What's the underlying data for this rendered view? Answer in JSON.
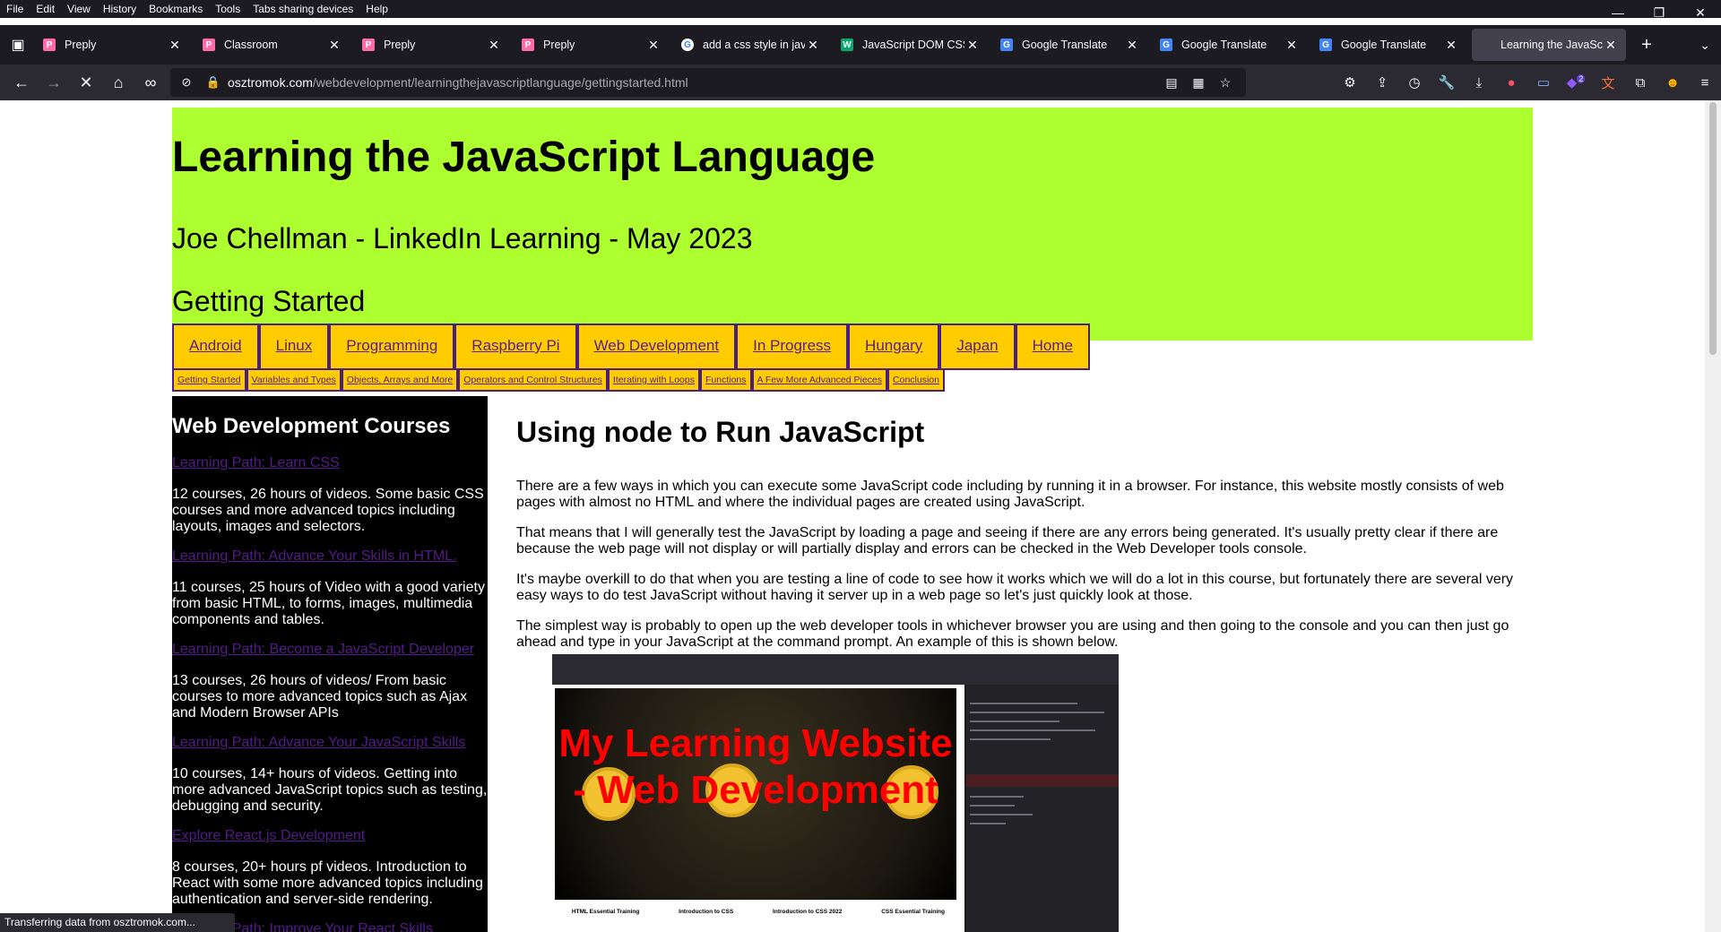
{
  "menubar": [
    "File",
    "Edit",
    "View",
    "History",
    "Bookmarks",
    "Tools",
    "Tabs sharing devices",
    "Help"
  ],
  "tabs": [
    {
      "title": "Preply",
      "favicon": "preply-icon",
      "color": "#ff6ba8",
      "glyph": "P"
    },
    {
      "title": "Classroom",
      "favicon": "preply-icon",
      "color": "#ff6ba8",
      "glyph": "P"
    },
    {
      "title": "Preply",
      "favicon": "preply-icon",
      "color": "#ff6ba8",
      "glyph": "P"
    },
    {
      "title": "Preply",
      "favicon": "preply-icon",
      "color": "#ff6ba8",
      "glyph": "P"
    },
    {
      "title": "add a css style in javasc",
      "favicon": "google-icon",
      "color": "#ffffff",
      "glyph": "G"
    },
    {
      "title": "JavaScript DOM CSS",
      "favicon": "w3schools-icon",
      "color": "#04aa6d",
      "glyph": "W"
    },
    {
      "title": "Google Translate",
      "favicon": "translate-icon",
      "color": "#4285f4",
      "glyph": "G"
    },
    {
      "title": "Google Translate",
      "favicon": "translate-icon",
      "color": "#4285f4",
      "glyph": "G"
    },
    {
      "title": "Google Translate",
      "favicon": "translate-icon",
      "color": "#4285f4",
      "glyph": "G"
    },
    {
      "title": "Learning the JavaScript",
      "favicon": "site-icon",
      "color": "#42414d",
      "glyph": "",
      "active": true
    }
  ],
  "url": {
    "host": "osztromok.com",
    "path": "/webdevelopment/learningthejavascriptlanguage/gettingstarted.html"
  },
  "header": {
    "title": "Learning the JavaScript Language",
    "subtitle": "Joe Chellman - LinkedIn Learning - May 2023",
    "page": "Getting Started",
    "bg_color": "#adff2f"
  },
  "main_nav": [
    "Android",
    "Linux",
    "Programming",
    "Raspberry Pi",
    "Web Development",
    "In Progress",
    "Hungary",
    "Japan",
    "Home"
  ],
  "sub_nav": [
    "Getting Started",
    "Variables and Types",
    "Objects, Arrays and More",
    "Operators and Control Structures",
    "Iterating with Loops",
    "Functions",
    "A Few More Advanced Pieces",
    "Conclusion"
  ],
  "sidebar": {
    "heading": "Web Development Courses",
    "courses": [
      {
        "link": "Learning Path: Learn CSS",
        "desc": "12 courses, 26 hours of videos. Some basic CSS courses and more advanced topics including layouts, images and selectors."
      },
      {
        "link": "Learning Path: Advance Your Skills in HTML.",
        "desc": "11 courses, 25 hours of Video with a good variety from basic HTML, to forms, images, multimedia components and tables."
      },
      {
        "link": "Learning Path: Become a JavaScript Developer",
        "desc": "13 courses, 26 hours of videos/ From basic courses to more advanced topics such as Ajax and Modern Browser APIs"
      },
      {
        "link": "Learning Path: Advance Your JavaScript Skills",
        "desc": "10 courses, 14+ hours of videos. Getting into more advanced JavaScript topics such as testing, debugging and security."
      },
      {
        "link": "Explore React.js Development",
        "desc": "8 courses, 20+ hours pf videos. Introduction to React with some more advanced topics including authentication and server-side rendering."
      },
      {
        "link": "Learning Path: Improve Your React Skills",
        "desc": ""
      }
    ]
  },
  "content": {
    "heading": "Using node to Run JavaScript",
    "paragraphs": [
      "There are a few ways in which you can execute some JavaScript code including by running it in a browser. For instance, this website mostly consists of web pages with almost no HTML and where the individual pages are created using JavaScript.",
      "That means that I will generally test the JavaScript by loading a page and seeing if there are any errors being generated. It's usually pretty clear if there are because the web page will not display or will partially display and errors can be checked in the Web Developer tools console.",
      "It's maybe overkill to do that when you are testing a line of code to see how it works which we will do a lot in this course, but fortunately there are several very easy ways to do test JavaScript without having it server up in a web page so let's just quickly look at those.",
      "The simplest way is probably to open up the web developer tools in whichever browser you are using and then going to the console and you can then just go ahead and type in your JavaScript at the command prompt. An example of this is shown below."
    ]
  },
  "screenshot": {
    "banner_title": "My Learning Website - Web Development",
    "links": [
      "HTML Essential Training",
      "Introduction to CSS",
      "Introduction to CSS 2022",
      "CSS Essential Training"
    ]
  },
  "status": "Transferring data from osztromok.com...",
  "toolbar_badge": "2"
}
